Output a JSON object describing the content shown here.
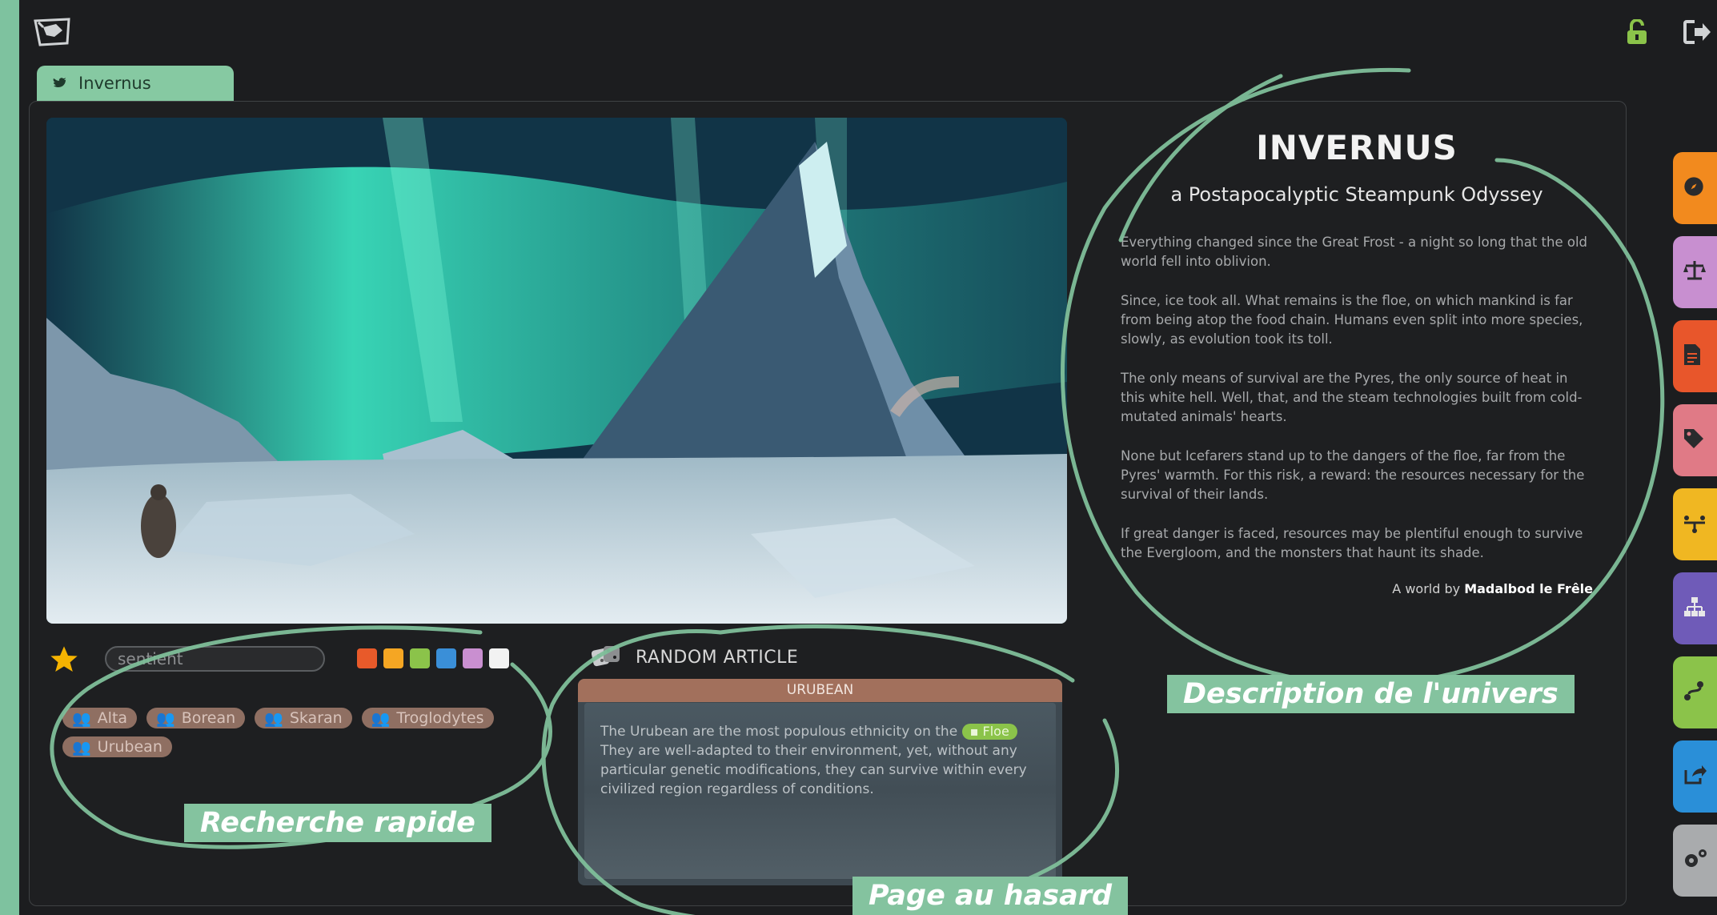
{
  "tab": {
    "label": "Invernus"
  },
  "description": {
    "title": "INVERNUS",
    "subtitle": "a Postapocalyptic Steampunk Odyssey",
    "paragraphs": [
      "Everything changed since the Great Frost - a night so long that the old world fell into oblivion.",
      "Since, ice took all. What remains is the floe, on which mankind is far from being atop the food chain. Humans even split into more species, slowly, as evolution took its toll.",
      "The only means of survival are the Pyres, the only source of heat in this white hell. Well, that, and the steam technologies built from cold-mutated animals' hearts.",
      "None but Icefarers stand up to the dangers of the floe, far from the Pyres' warmth. For this risk, a reward: the resources necessary for the survival of their lands.",
      "If great danger is faced, resources may be plentiful enough to survive the Evergloom, and the monsters that haunt its shade."
    ],
    "credit_prefix": "A world by",
    "credit_author": "Madalbod le Frêle"
  },
  "search": {
    "value": "sentient"
  },
  "color_filters": [
    "#e85a2a",
    "#f5a623",
    "#8bc34a",
    "#3a8fd8",
    "#c98fd0",
    "#f2f2f2"
  ],
  "chips": [
    "Alta",
    "Borean",
    "Skaran",
    "Troglodytes",
    "Urubean"
  ],
  "random": {
    "heading": "RANDOM ARTICLE",
    "article_title": "URUBEAN",
    "text_before_tag": "The Urubean are the most populous ethnicity on the",
    "tag": "Floe",
    "text_after_tag": "They are well-adapted to their environment, yet, without any particular genetic modifications, they can survive within every civilized region regardless of conditions."
  },
  "annotations": {
    "quick_search": "Recherche rapide",
    "random_page": "Page au hasard",
    "universe_desc": "Description de l'univers"
  },
  "side_buttons": [
    {
      "icon": "compass-icon",
      "color": "#f28a1e"
    },
    {
      "icon": "scales-icon",
      "color": "#c88fd0"
    },
    {
      "icon": "document-icon",
      "color": "#e8562b"
    },
    {
      "icon": "tag-icon",
      "color": "#e07a86"
    },
    {
      "icon": "connections-icon",
      "color": "#f0b722"
    },
    {
      "icon": "hierarchy-icon",
      "color": "#6f5bb8"
    },
    {
      "icon": "route-icon",
      "color": "#8bc34a"
    },
    {
      "icon": "share-icon",
      "color": "#2a8fd8"
    },
    {
      "icon": "settings-icon",
      "color": "#a9abad"
    }
  ]
}
